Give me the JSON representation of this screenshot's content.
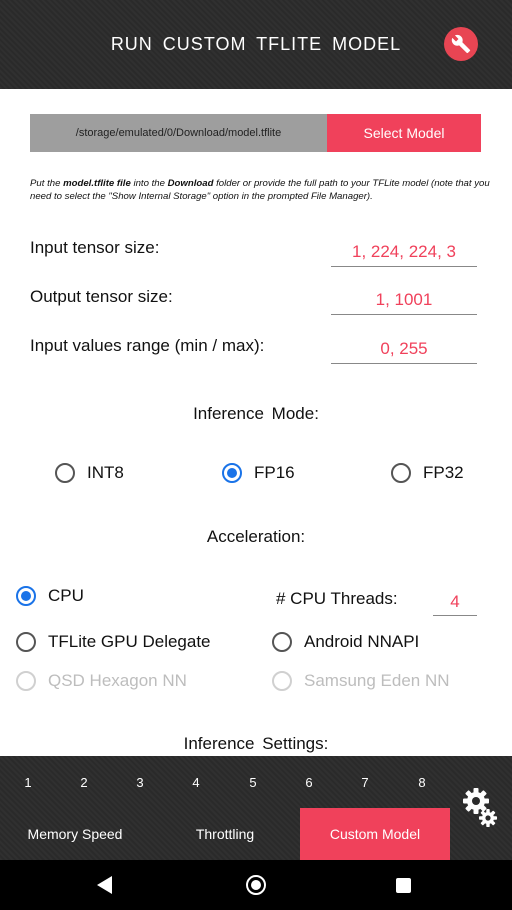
{
  "header": {
    "title": "RUN  CUSTOM  TFLITE  MODEL",
    "wrench_icon": "wrench-icon"
  },
  "model": {
    "path": "/storage/emulated/0/Download/model.tflite",
    "select_label": "Select Model"
  },
  "note": {
    "p1": "Put the ",
    "b1": "model.tflite file",
    "p2": " into the ",
    "b2": "Download",
    "p3": " folder or provide the full path to your TFLite model (note that you need to select the \"Show Internal Storage\" option in the prompted File Manager)."
  },
  "fields": {
    "input_size": {
      "label": "Input tensor size:",
      "value": "1, 224, 224, 3"
    },
    "output_size": {
      "label": "Output tensor size:",
      "value": "1, 1001"
    },
    "value_range": {
      "label": "Input values range (min / max):",
      "value": "0, 255"
    }
  },
  "inference_mode": {
    "title": "Inference  Mode:",
    "options": {
      "int8": "INT8",
      "fp16": "FP16",
      "fp32": "FP32"
    },
    "selected": "FP16"
  },
  "acceleration": {
    "title": "Acceleration:",
    "options": {
      "cpu": "CPU",
      "gpu": "TFLite GPU Delegate",
      "nnapi": "Android NNAPI",
      "hexagon": "QSD Hexagon NN",
      "eden": "Samsung Eden NN"
    },
    "selected": "CPU",
    "threads_label": "# CPU Threads:",
    "threads_value": "4"
  },
  "inference_settings": {
    "title": "Inference Settings:"
  },
  "bottom_nav": {
    "numbers": [
      "1",
      "2",
      "3",
      "4",
      "5",
      "6",
      "7",
      "8"
    ],
    "tabs": {
      "memory": "Memory Speed",
      "throttling": "Throttling",
      "custom": "Custom Model"
    },
    "active_tab": "Custom Model",
    "settings_icon": "gears-icon"
  },
  "colors": {
    "accent": "#f0415b",
    "radio_selected": "#1a73e8",
    "header_bg": "#2b2b2b"
  }
}
